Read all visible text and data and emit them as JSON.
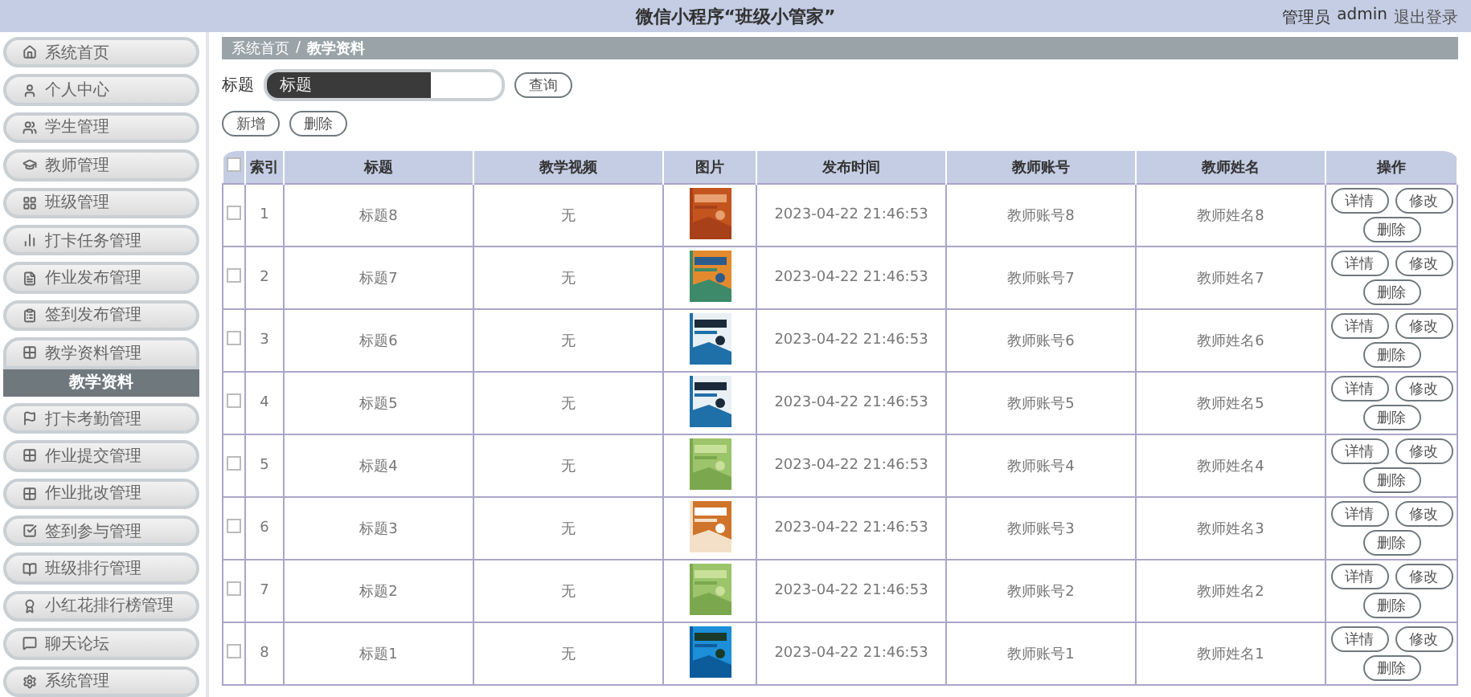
{
  "header": {
    "title": "微信小程序“班级小管家”",
    "role": "管理员",
    "user": "admin",
    "logout": "退出登录"
  },
  "sidebar": {
    "items": [
      {
        "label": "系统首页",
        "selected": false
      },
      {
        "label": "个人中心",
        "selected": false
      },
      {
        "label": "学生管理",
        "selected": false
      },
      {
        "label": "教师管理",
        "selected": false
      },
      {
        "label": "班级管理",
        "selected": false
      },
      {
        "label": "打卡任务管理",
        "selected": false
      },
      {
        "label": "作业发布管理",
        "selected": false
      },
      {
        "label": "签到发布管理",
        "selected": false
      },
      {
        "label": "教学资料管理",
        "selected": false,
        "expanded": true,
        "children": [
          {
            "label": "教学资料",
            "selected": true
          }
        ]
      },
      {
        "label": "打卡考勤管理",
        "selected": false
      },
      {
        "label": "作业提交管理",
        "selected": false
      },
      {
        "label": "作业批改管理",
        "selected": false
      },
      {
        "label": "签到参与管理",
        "selected": false
      },
      {
        "label": "班级排行管理",
        "selected": false
      },
      {
        "label": "小红花排行榜管理",
        "selected": false
      },
      {
        "label": "聊天论坛",
        "selected": false
      },
      {
        "label": "系统管理",
        "selected": false
      }
    ]
  },
  "breadcrumb": {
    "items": [
      "系统首页",
      "教学资料"
    ],
    "separator": "/"
  },
  "search": {
    "label": "标题",
    "placeholder": "标题",
    "button": "查询"
  },
  "actions": [
    "新增",
    "删除"
  ],
  "table": {
    "select_all_checked": false,
    "columns": [
      "索引",
      "标题",
      "教学视频",
      "图片",
      "发布时间",
      "教师账号",
      "教师姓名",
      "操作"
    ],
    "rows": [
      {
        "checked": false,
        "index": "1",
        "title": "标题8",
        "video": "无",
        "time": "2023-04-22 21:46:53",
        "account": "教师账号8",
        "name": "教师姓名8",
        "ops": [
          "详情",
          "修改",
          "删除"
        ]
      },
      {
        "checked": false,
        "index": "2",
        "title": "标题7",
        "video": "无",
        "time": "2023-04-22 21:46:53",
        "account": "教师账号7",
        "name": "教师姓名7",
        "ops": [
          "详情",
          "修改",
          "删除"
        ]
      },
      {
        "checked": false,
        "index": "3",
        "title": "标题6",
        "video": "无",
        "time": "2023-04-22 21:46:53",
        "account": "教师账号6",
        "name": "教师姓名6",
        "ops": [
          "详情",
          "修改",
          "删除"
        ]
      },
      {
        "checked": false,
        "index": "4",
        "title": "标题5",
        "video": "无",
        "time": "2023-04-22 21:46:53",
        "account": "教师账号5",
        "name": "教师姓名5",
        "ops": [
          "详情",
          "修改",
          "删除"
        ]
      },
      {
        "checked": false,
        "index": "5",
        "title": "标题4",
        "video": "无",
        "time": "2023-04-22 21:46:53",
        "account": "教师账号4",
        "name": "教师姓名4",
        "ops": [
          "详情",
          "修改",
          "删除"
        ]
      },
      {
        "checked": false,
        "index": "6",
        "title": "标题3",
        "video": "无",
        "time": "2023-04-22 21:46:53",
        "account": "教师账号3",
        "name": "教师姓名3",
        "ops": [
          "详情",
          "修改",
          "删除"
        ]
      },
      {
        "checked": false,
        "index": "7",
        "title": "标题2",
        "video": "无",
        "time": "2023-04-22 21:46:53",
        "account": "教师账号2",
        "name": "教师姓名2",
        "ops": [
          "详情",
          "修改",
          "删除"
        ]
      },
      {
        "checked": false,
        "index": "8",
        "title": "标题1",
        "video": "无",
        "time": "2023-04-22 21:46:53",
        "account": "教师账号1",
        "name": "教师姓名1",
        "ops": [
          "详情",
          "修改",
          "删除"
        ]
      }
    ]
  }
}
